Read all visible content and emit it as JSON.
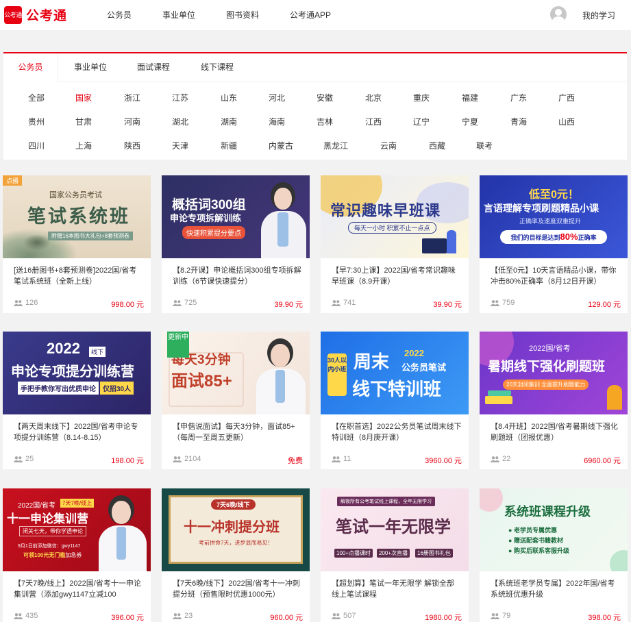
{
  "header": {
    "logo_mark": "公考通",
    "logo_text": "公考通",
    "nav": [
      "公务员",
      "事业单位",
      "图书资料",
      "公考通APP"
    ],
    "my_study": "我的学习"
  },
  "filter": {
    "tabs": [
      "公务员",
      "事业单位",
      "面试课程",
      "线下课程"
    ],
    "regions_row1": [
      "全部",
      "国家",
      "浙江",
      "江苏",
      "山东",
      "河北",
      "安徽",
      "北京",
      "重庆",
      "福建",
      "广东",
      "广西"
    ],
    "regions_row2": [
      "贵州",
      "甘肃",
      "河南",
      "湖北",
      "湖南",
      "海南",
      "吉林",
      "江西",
      "辽宁",
      "宁夏",
      "青海",
      "山西"
    ],
    "regions_row3": [
      "四川",
      "上海",
      "陕西",
      "天津",
      "新疆",
      "内蒙古",
      "黑龙江",
      "云南",
      "西藏",
      "联考"
    ]
  },
  "courses": [
    {
      "badge": "点播",
      "banner": {
        "title": "笔试系统班",
        "sub1": "国家公务员考试",
        "sub2": "附赠16本图书大礼包+8套预测卷"
      },
      "title": "[送16册图书+8套预测卷]2022国/省考笔试系统班（全新上线）",
      "count": "126",
      "price": "998.00 元"
    },
    {
      "banner": {
        "title": "概括词300组",
        "sub1": "申论专项拆解训练",
        "sub2": "快速积累提分要点"
      },
      "title": "【8.2开课】申论概括词300组专项拆解训练（6节课快速提分）",
      "count": "725",
      "price": "39.90 元"
    },
    {
      "banner": {
        "title": "常识趣味早班课",
        "sub1": "每天一小时 积累不止一点点"
      },
      "title": "【早7:30上课】2022国/省考常识趣味早班课（8.9开课）",
      "count": "741",
      "price": "39.90 元"
    },
    {
      "banner": {
        "title": "低至0元！",
        "sub1": "言语理解专项刷题精品小课",
        "sub2": "正确率及速度双重提升",
        "sub3": "我们的目标是达到",
        "sub4": "80%",
        "sub5": "正确率"
      },
      "title": "【低至0元】10天言语精品小课，带你冲击80%正确率（8月12日开课）",
      "count": "759",
      "price": "129.00 元"
    },
    {
      "banner": {
        "title": "2022",
        "tag": "线下",
        "sub1": "申论专项提分训练营",
        "sub2": "手把手教你写出优质申论",
        "sub3": "仅招30人"
      },
      "title": "【两天周末线下】2022国/省考申论专项提分训练营（8.14-8.15）",
      "count": "25",
      "price": "198.00 元"
    },
    {
      "badge": "更新中",
      "banner": {
        "title": "每天3分钟",
        "sub1": "面试85+"
      },
      "title": "【申偕说面试】每天3分钟，面试85+（每周一至周五更新）",
      "count": "2104",
      "price": "免费"
    },
    {
      "banner": {
        "title": "周末",
        "sub1": "2022",
        "sub2": "公务员笔试",
        "sub3": "线下特训班",
        "tag": "30人以内小班"
      },
      "title": "【在职首选】2022公务员笔试周末线下特训班（8月庚开课）",
      "count": "11",
      "price": "3960.00 元"
    },
    {
      "banner": {
        "title": "2022国/省考",
        "sub1": "暑期线下强化刷题班",
        "sub2": "20天封闭集训 全面提升刷题能力"
      },
      "title": "【8.4开班】2022国/省考暑期线下强化刷题班（团报优惠）",
      "count": "22",
      "price": "6960.00 元"
    },
    {
      "banner": {
        "title": "十一申论集训营",
        "sub1": "2022国/省考",
        "tag": "7天7晚/线上",
        "sub2": "闭关七天，带你学透申论",
        "sub3": "9月1日前添加微信：gwy1147",
        "sub4": "可领100元无门槛",
        "sub5": "加急券"
      },
      "title": "【7天7晚/线上】2022国/省考十一申论集训营（添加gwy1147立减100",
      "count": "435",
      "price": "396.00 元"
    },
    {
      "banner": {
        "title": "十一冲刺提分班",
        "tag": "7天6晚/线下",
        "sub1": "考前拼命7天，进步显而易见！"
      },
      "title": "【7天6晚/线下】2022国/省考十一冲刺提分班（预售限时优惠1000元）",
      "count": "23",
      "price": "960.00 元"
    },
    {
      "banner": {
        "title": "笔试一年无限学",
        "sub1": "解锁所有公考笔试线上课程，全年无限学习",
        "tags": [
          "100+点播课时",
          "200+次直播",
          "16册图书礼包"
        ]
      },
      "title": "【超划算】笔试一年无限学 解锁全部线上笔试课程",
      "count": "507",
      "price": "1980.00 元"
    },
    {
      "banner": {
        "title": "系统班课程升级",
        "items": [
          "老学员专属优惠",
          "赠送配套书籍教材",
          "购买后联系客服升级"
        ]
      },
      "title": "【系统班老学员专属】2022年国/省考系统班优惠升级",
      "count": "79",
      "price": "398.00 元"
    }
  ],
  "colors": {
    "brand": "#e60012",
    "price": "#e60012",
    "muted": "#999999"
  }
}
